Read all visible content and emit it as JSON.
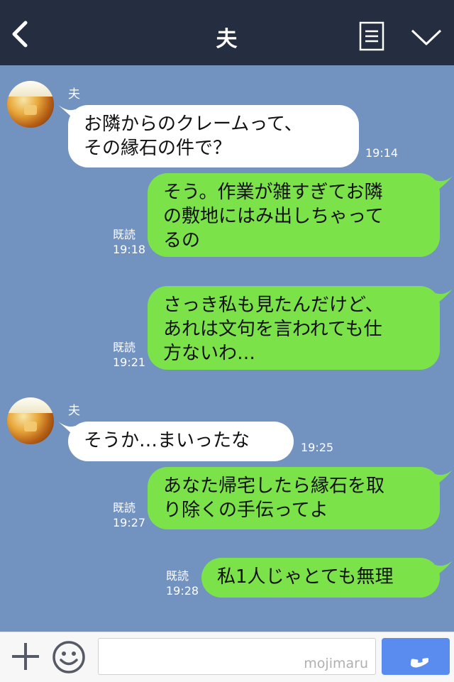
{
  "header": {
    "title": "夫",
    "back_icon": "chevron-left-icon",
    "note_icon": "note-icon",
    "menu_icon": "chevron-down-icon"
  },
  "messages": [
    {
      "sender": "夫",
      "side": "in",
      "text": "お隣からのクレームって、\nその縁石の件で？",
      "time": "19:14"
    },
    {
      "side": "out",
      "text": "そう。作業が雑すぎてお隣\nの敷地にはみ出しちゃって\nるの",
      "read": "既読",
      "time": "19:18"
    },
    {
      "side": "out",
      "text": "さっき私も見たんだけど、\nあれは文句を言われても仕\n方ないわ…",
      "read": "既読",
      "time": "19:21"
    },
    {
      "sender": "夫",
      "side": "in",
      "text": "そうか…まいったな",
      "time": "19:25"
    },
    {
      "side": "out",
      "text": "あなた帰宅したら縁石を取\nり除くの手伝ってよ",
      "read": "既読",
      "time": "19:27"
    },
    {
      "side": "out",
      "text": "私1人じゃとても無理",
      "read": "既読",
      "time": "19:28"
    }
  ],
  "input": {
    "placeholder": "",
    "watermark": "mojimaru",
    "plus_icon": "plus-icon",
    "emoji_icon": "smiley-icon",
    "send_icon": "phone-icon"
  },
  "colors": {
    "background": "#7292c0",
    "header": "#252e41",
    "outgoing": "#7ce24a",
    "incoming": "#ffffff",
    "send": "#5a8cf0"
  }
}
